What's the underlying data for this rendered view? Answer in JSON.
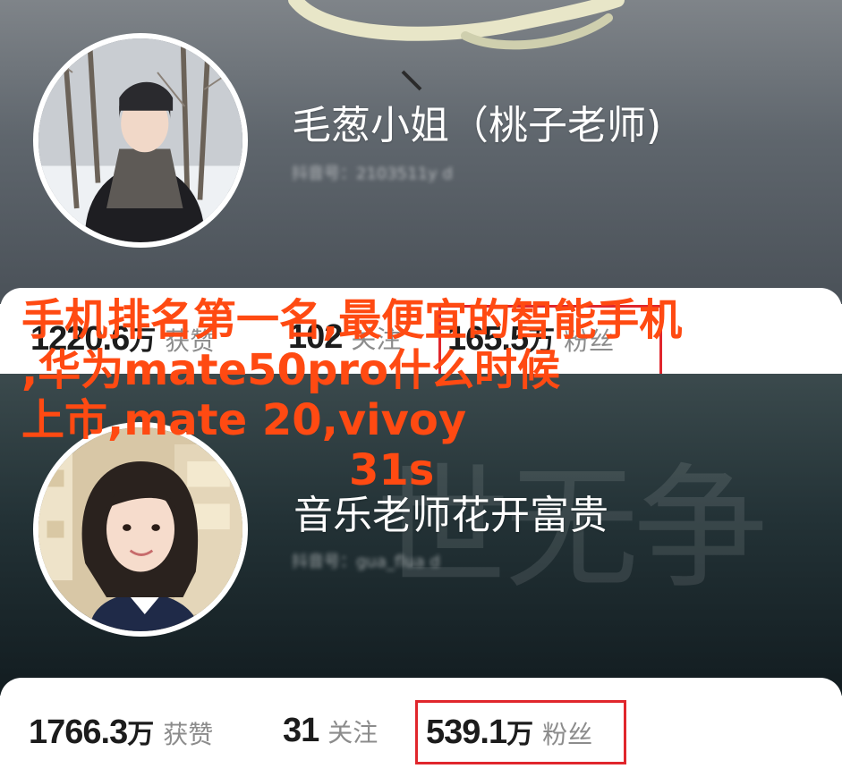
{
  "profile1": {
    "name": "毛葱小姐（桃子老师)",
    "handle": "抖音号：2103511y d",
    "stats": {
      "likes_value": "1220.6",
      "likes_unit": "万",
      "likes_label": "获赞",
      "following_value": "102",
      "following_label": "关注",
      "followers_value": "165.5",
      "followers_unit": "万",
      "followers_label": "粉丝"
    }
  },
  "profile2": {
    "name": "音乐老师花开富贵",
    "handle": "抖音号：gua_flua d",
    "watermark": "世无争",
    "stats": {
      "likes_value": "1766.3",
      "likes_unit": "万",
      "likes_label": "获赞",
      "following_value": "31",
      "following_label": "关注",
      "followers_value": "539.1",
      "followers_unit": "万",
      "followers_label": "粉丝"
    }
  },
  "overlay_title": {
    "line1": "手机排名第一名,最便宜的智能手机",
    "line2": ",华为mate50pro什么时候",
    "line3": "上市,mate 20,vivoy",
    "line4": "31s"
  },
  "colors": {
    "highlight_box": "#e0262c",
    "overlay_text": "#ff4a12"
  }
}
